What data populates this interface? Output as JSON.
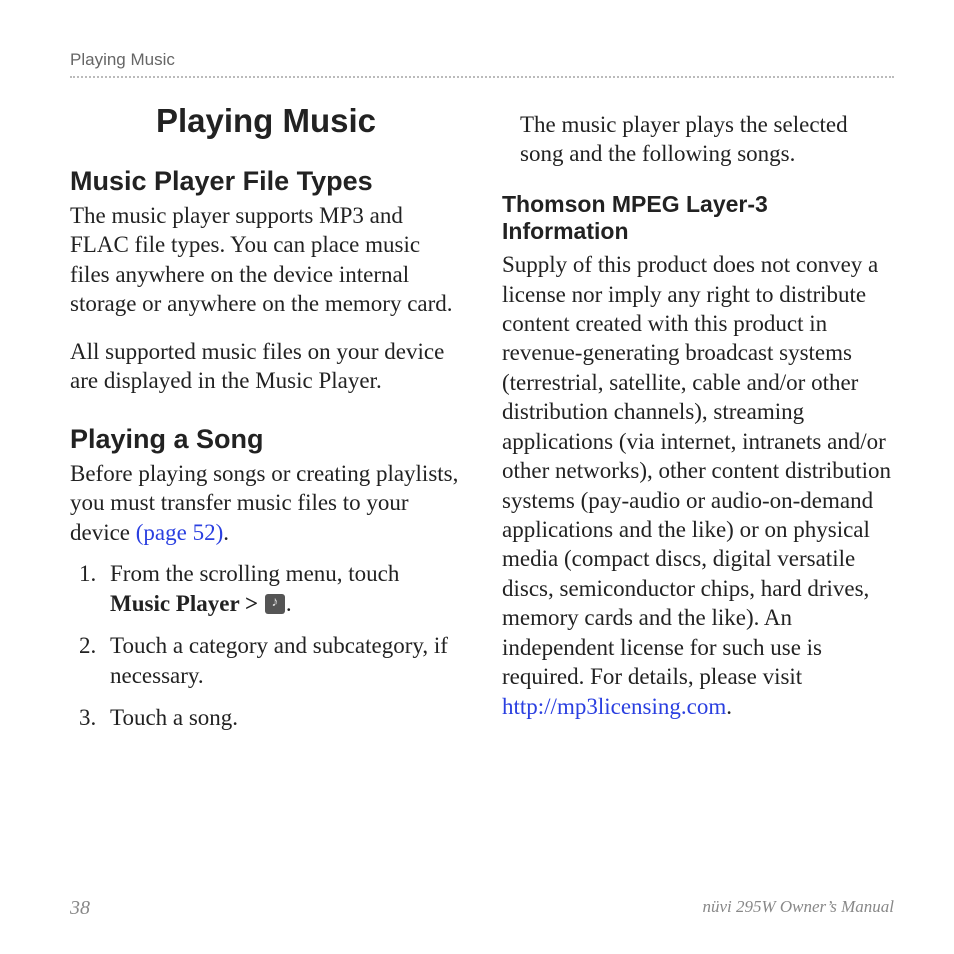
{
  "running_head": "Playing Music",
  "chapter_title": "Playing Music",
  "section_file_types": {
    "title": "Music Player File Types",
    "p1": "The music player supports MP3 and FLAC file types. You can place music files anywhere on the device internal storage or anywhere on the memory card.",
    "p2": "All supported music files on your device are displayed in the Music Player."
  },
  "section_play_song": {
    "title": "Playing a Song",
    "intro_prefix": "Before playing songs or creating playlists, you must transfer music files to your device ",
    "intro_link": "(page 52)",
    "intro_suffix": ".",
    "steps": {
      "s1_prefix": "From the scrolling menu, touch ",
      "s1_bold": "Music Player > ",
      "s1_suffix": ".",
      "s2": "Touch a category and subcategory, if necessary.",
      "s3": "Touch a song."
    }
  },
  "col2_lead": "The music player plays the selected song and the following songs.",
  "thomson": {
    "title": "Thomson MPEG Layer-3 Information",
    "body_prefix": "Supply of this product does not convey a license nor imply any right to distribute content created with this product in revenue-generating broadcast systems (terrestrial, satellite, cable and/or other distribution channels), streaming applications (via internet, intranets and/or other networks), other content distribution systems (pay-audio or audio-on-demand applications and the like) or on physical media (compact discs, digital versatile discs, semiconductor chips, hard drives, memory cards and the like). An independent license for such use is required. For details, please visit ",
    "body_link": "http://mp3licensing.com",
    "body_suffix": "."
  },
  "footer": {
    "page_no": "38",
    "manual": "nüvi 295W Owner’s Manual"
  }
}
